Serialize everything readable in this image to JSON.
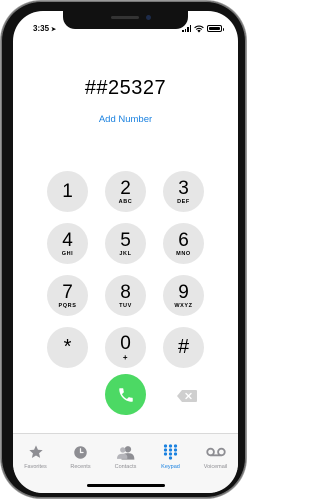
{
  "status_bar": {
    "time": "3:35",
    "location_arrow": "➤"
  },
  "dialer": {
    "number": "##25327",
    "add_number_label": "Add Number"
  },
  "keypad": [
    {
      "digit": "1",
      "letters": ""
    },
    {
      "digit": "2",
      "letters": "ABC"
    },
    {
      "digit": "3",
      "letters": "DEF"
    },
    {
      "digit": "4",
      "letters": "GHI"
    },
    {
      "digit": "5",
      "letters": "JKL"
    },
    {
      "digit": "6",
      "letters": "MNO"
    },
    {
      "digit": "7",
      "letters": "PQRS"
    },
    {
      "digit": "8",
      "letters": "TUV"
    },
    {
      "digit": "9",
      "letters": "WXYZ"
    },
    {
      "digit": "*",
      "letters": ""
    },
    {
      "digit": "0",
      "letters": "+"
    },
    {
      "digit": "#",
      "letters": ""
    }
  ],
  "tabs": [
    {
      "label": "Favorites",
      "icon": "star-icon",
      "active": false
    },
    {
      "label": "Recents",
      "icon": "clock-icon",
      "active": false
    },
    {
      "label": "Contacts",
      "icon": "contacts-icon",
      "active": false
    },
    {
      "label": "Keypad",
      "icon": "keypad-icon",
      "active": true
    },
    {
      "label": "Voicemail",
      "icon": "voicemail-icon",
      "active": false
    }
  ],
  "colors": {
    "accent": "#1b82e0",
    "call_green": "#4cd964",
    "key_gray": "#e6e6e6",
    "inactive_tab": "#8e8e93"
  }
}
